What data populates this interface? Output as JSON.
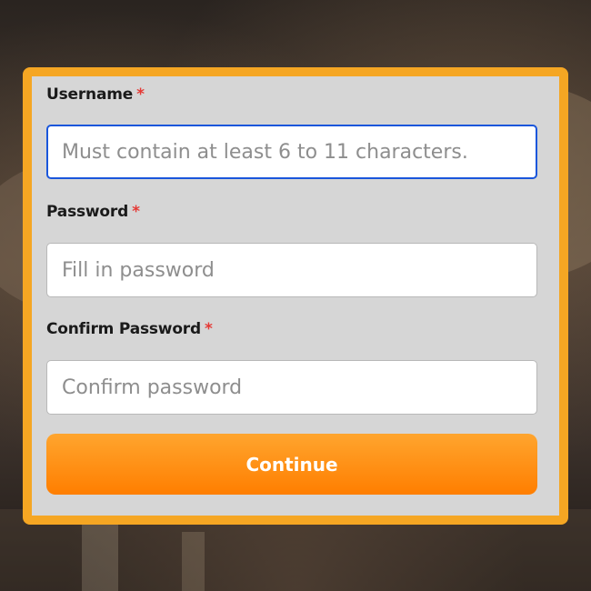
{
  "colors": {
    "card_border": "#f5a623",
    "card_background": "#d6d6d6",
    "focus_border": "#1a56db",
    "required_mark": "#e53935",
    "button_gradient_top": "#ffa52e",
    "button_gradient_bottom": "#ff7e00",
    "button_text": "#ffffff"
  },
  "form": {
    "username": {
      "label": "Username",
      "required_mark": "*",
      "placeholder": "Must contain at least 6 to 11 characters.",
      "value": "",
      "focused": true
    },
    "password": {
      "label": "Password",
      "required_mark": "*",
      "placeholder": "Fill in password",
      "value": ""
    },
    "confirm_password": {
      "label": "Confirm Password",
      "required_mark": "*",
      "placeholder": "Confirm password",
      "value": ""
    },
    "continue_label": "Continue"
  }
}
